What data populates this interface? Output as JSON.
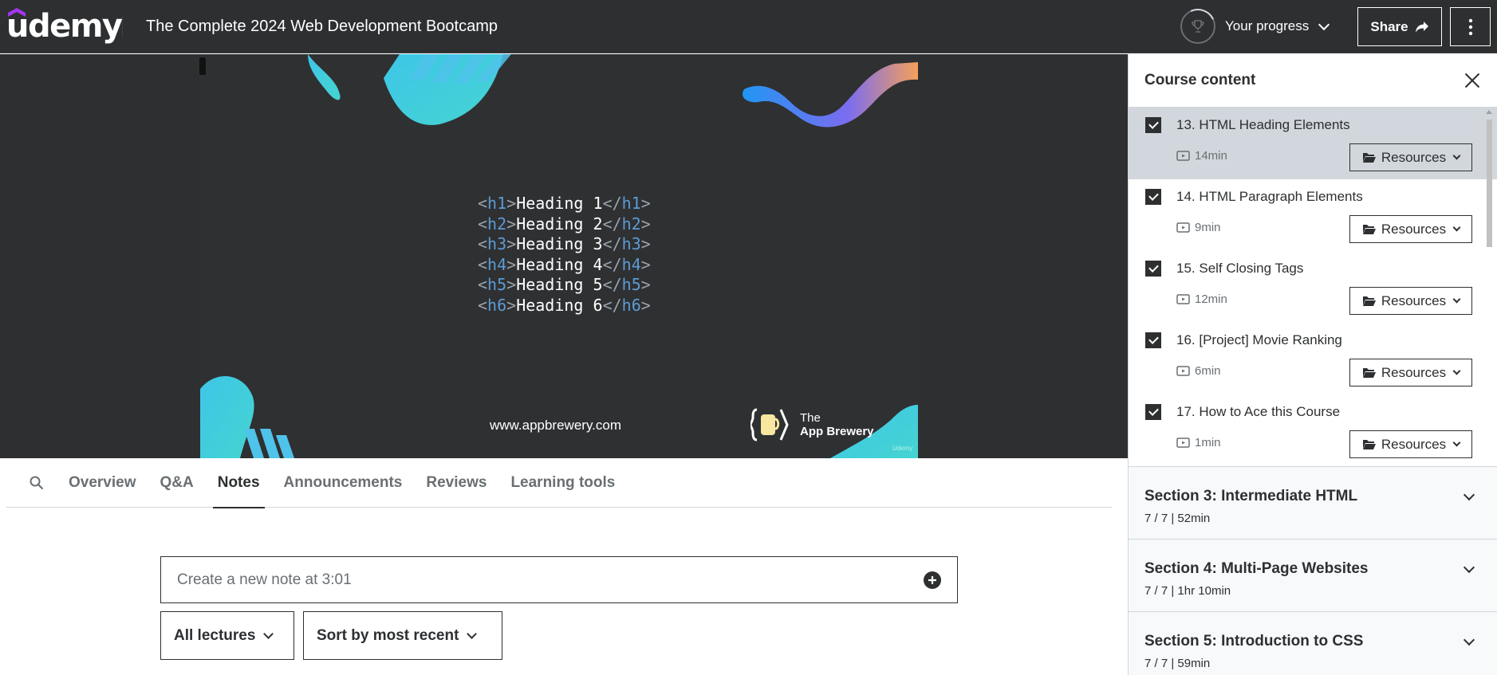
{
  "header": {
    "logo": "udemy",
    "course_title": "The Complete 2024 Web Development Bootcamp",
    "progress_label": "Your progress",
    "share_label": "Share",
    "more_icon": "more-vertical-icon"
  },
  "video": {
    "code_lines": [
      {
        "open": "h1",
        "text": "Heading 1",
        "close": "h1"
      },
      {
        "open": "h2",
        "text": "Heading 2",
        "close": "h2"
      },
      {
        "open": "h3",
        "text": "Heading 3",
        "close": "h3"
      },
      {
        "open": "h4",
        "text": "Heading 4",
        "close": "h4"
      },
      {
        "open": "h5",
        "text": "Heading 5",
        "close": "h5"
      },
      {
        "open": "h6",
        "text": "Heading 6",
        "close": "h6"
      }
    ],
    "site_url": "www.appbrewery.com",
    "brand_line1": "The",
    "brand_line2": "App Brewery",
    "corner_mark": "Udemy"
  },
  "tabs": {
    "items": [
      "Overview",
      "Q&A",
      "Notes",
      "Announcements",
      "Reviews",
      "Learning tools"
    ],
    "active": "Notes"
  },
  "notes": {
    "new_note_placeholder": "Create a new note at 3:01",
    "filter_lectures": "All lectures",
    "sort": "Sort by most recent"
  },
  "sidebar": {
    "title": "Course content",
    "lectures": [
      {
        "title": "13. HTML Heading Elements",
        "duration": "14min",
        "resources": "Resources",
        "current": true
      },
      {
        "title": "14. HTML Paragraph Elements",
        "duration": "9min",
        "resources": "Resources",
        "current": false
      },
      {
        "title": "15. Self Closing Tags",
        "duration": "12min",
        "resources": "Resources",
        "current": false
      },
      {
        "title": "16. [Project] Movie Ranking",
        "duration": "6min",
        "resources": "Resources",
        "current": false
      },
      {
        "title": "17. How to Ace this Course",
        "duration": "1min",
        "resources": "Resources",
        "current": false
      }
    ],
    "sections": [
      {
        "title": "Section 3: Intermediate HTML",
        "meta": "7 / 7 | 52min"
      },
      {
        "title": "Section 4: Multi-Page Websites",
        "meta": "7 / 7 | 1hr 10min"
      },
      {
        "title": "Section 5: Introduction to CSS",
        "meta": "7 / 7 | 59min"
      }
    ]
  },
  "colors": {
    "header_bg": "#2d2f31",
    "accent_purple": "#a435f0",
    "current_lecture_bg": "#d1d7dc",
    "code_tag": "#5b9bd5"
  }
}
